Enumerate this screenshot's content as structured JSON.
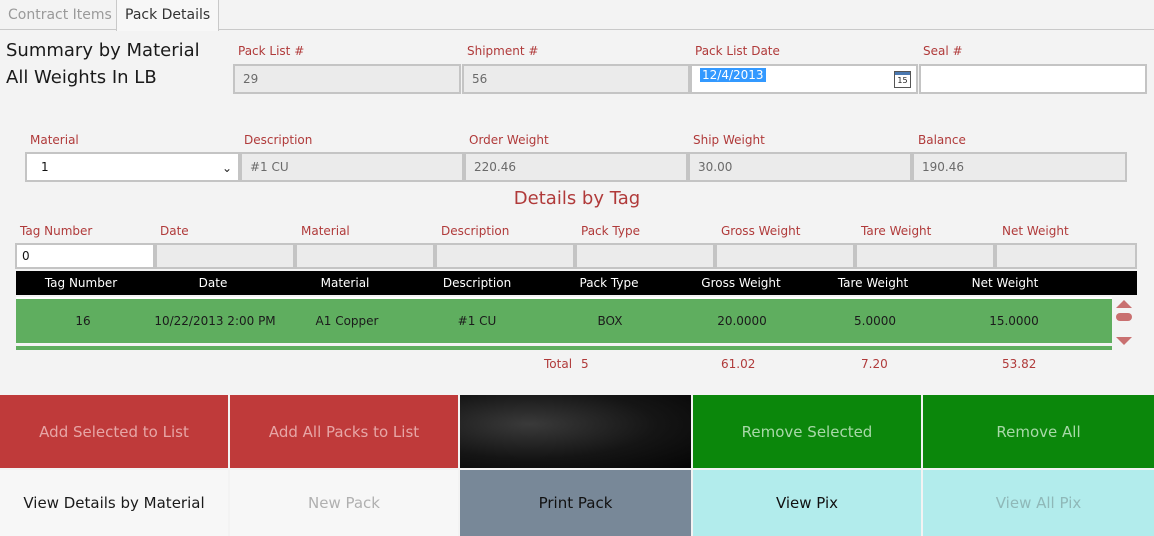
{
  "tabs": [
    {
      "label": "Contract Items",
      "active": false
    },
    {
      "label": "Pack Details",
      "active": true
    }
  ],
  "summary": {
    "title": "Summary by Material",
    "subtitle": "All Weights In LB"
  },
  "header_fields": {
    "pack_list": {
      "label": "Pack List #",
      "value": "29"
    },
    "shipment": {
      "label": "Shipment #",
      "value": "56"
    },
    "pack_list_date": {
      "label": "Pack List Date",
      "value": "12/4/2013",
      "calendar_day": "15"
    },
    "seal": {
      "label": "Seal #",
      "value": ""
    }
  },
  "material_fields": {
    "material": {
      "label": "Material",
      "value": "1"
    },
    "description": {
      "label": "Description",
      "value": "#1 CU"
    },
    "order_weight": {
      "label": "Order Weight",
      "value": "220.46"
    },
    "ship_weight": {
      "label": "Ship Weight",
      "value": "30.00"
    },
    "balance": {
      "label": "Balance",
      "value": "190.46"
    }
  },
  "details_title": "Details by Tag",
  "filter": {
    "labels": [
      "Tag Number",
      "Date",
      "Material",
      "Description",
      "Pack Type",
      "Gross Weight",
      "Tare Weight",
      "Net Weight"
    ],
    "values": [
      "0",
      "",
      "",
      "",
      "",
      "",
      "",
      ""
    ]
  },
  "grid": {
    "columns": [
      "Tag Number",
      "Date",
      "Material",
      "Description",
      "Pack Type",
      "Gross Weight",
      "Tare Weight",
      "Net Weight"
    ],
    "rows": [
      [
        "16",
        "10/22/2013 2:00 PM",
        "A1 Copper",
        "#1 CU",
        "BOX",
        "20.0000",
        "5.0000",
        "15.0000"
      ]
    ]
  },
  "totals": {
    "label": "Total",
    "count": "5",
    "gross": "61.02",
    "tare": "7.20",
    "net": "53.82"
  },
  "buttons": {
    "add_selected": "Add Selected to List",
    "add_all_packs": "Add All Packs to List",
    "remove_selected": "Remove Selected",
    "remove_all": "Remove All",
    "view_details_by_material": "View Details by Material",
    "new_pack": "New Pack",
    "print_pack": "Print Pack",
    "view_pix": "View Pix",
    "view_all_pix": "View All Pix"
  },
  "colors": {
    "accent_red": "#b03a3a",
    "row_green": "#5fae5f",
    "button_red": "#bf3a3a",
    "button_green": "#0b870b",
    "button_slate": "#788898",
    "button_aqua": "#b2ecec"
  }
}
